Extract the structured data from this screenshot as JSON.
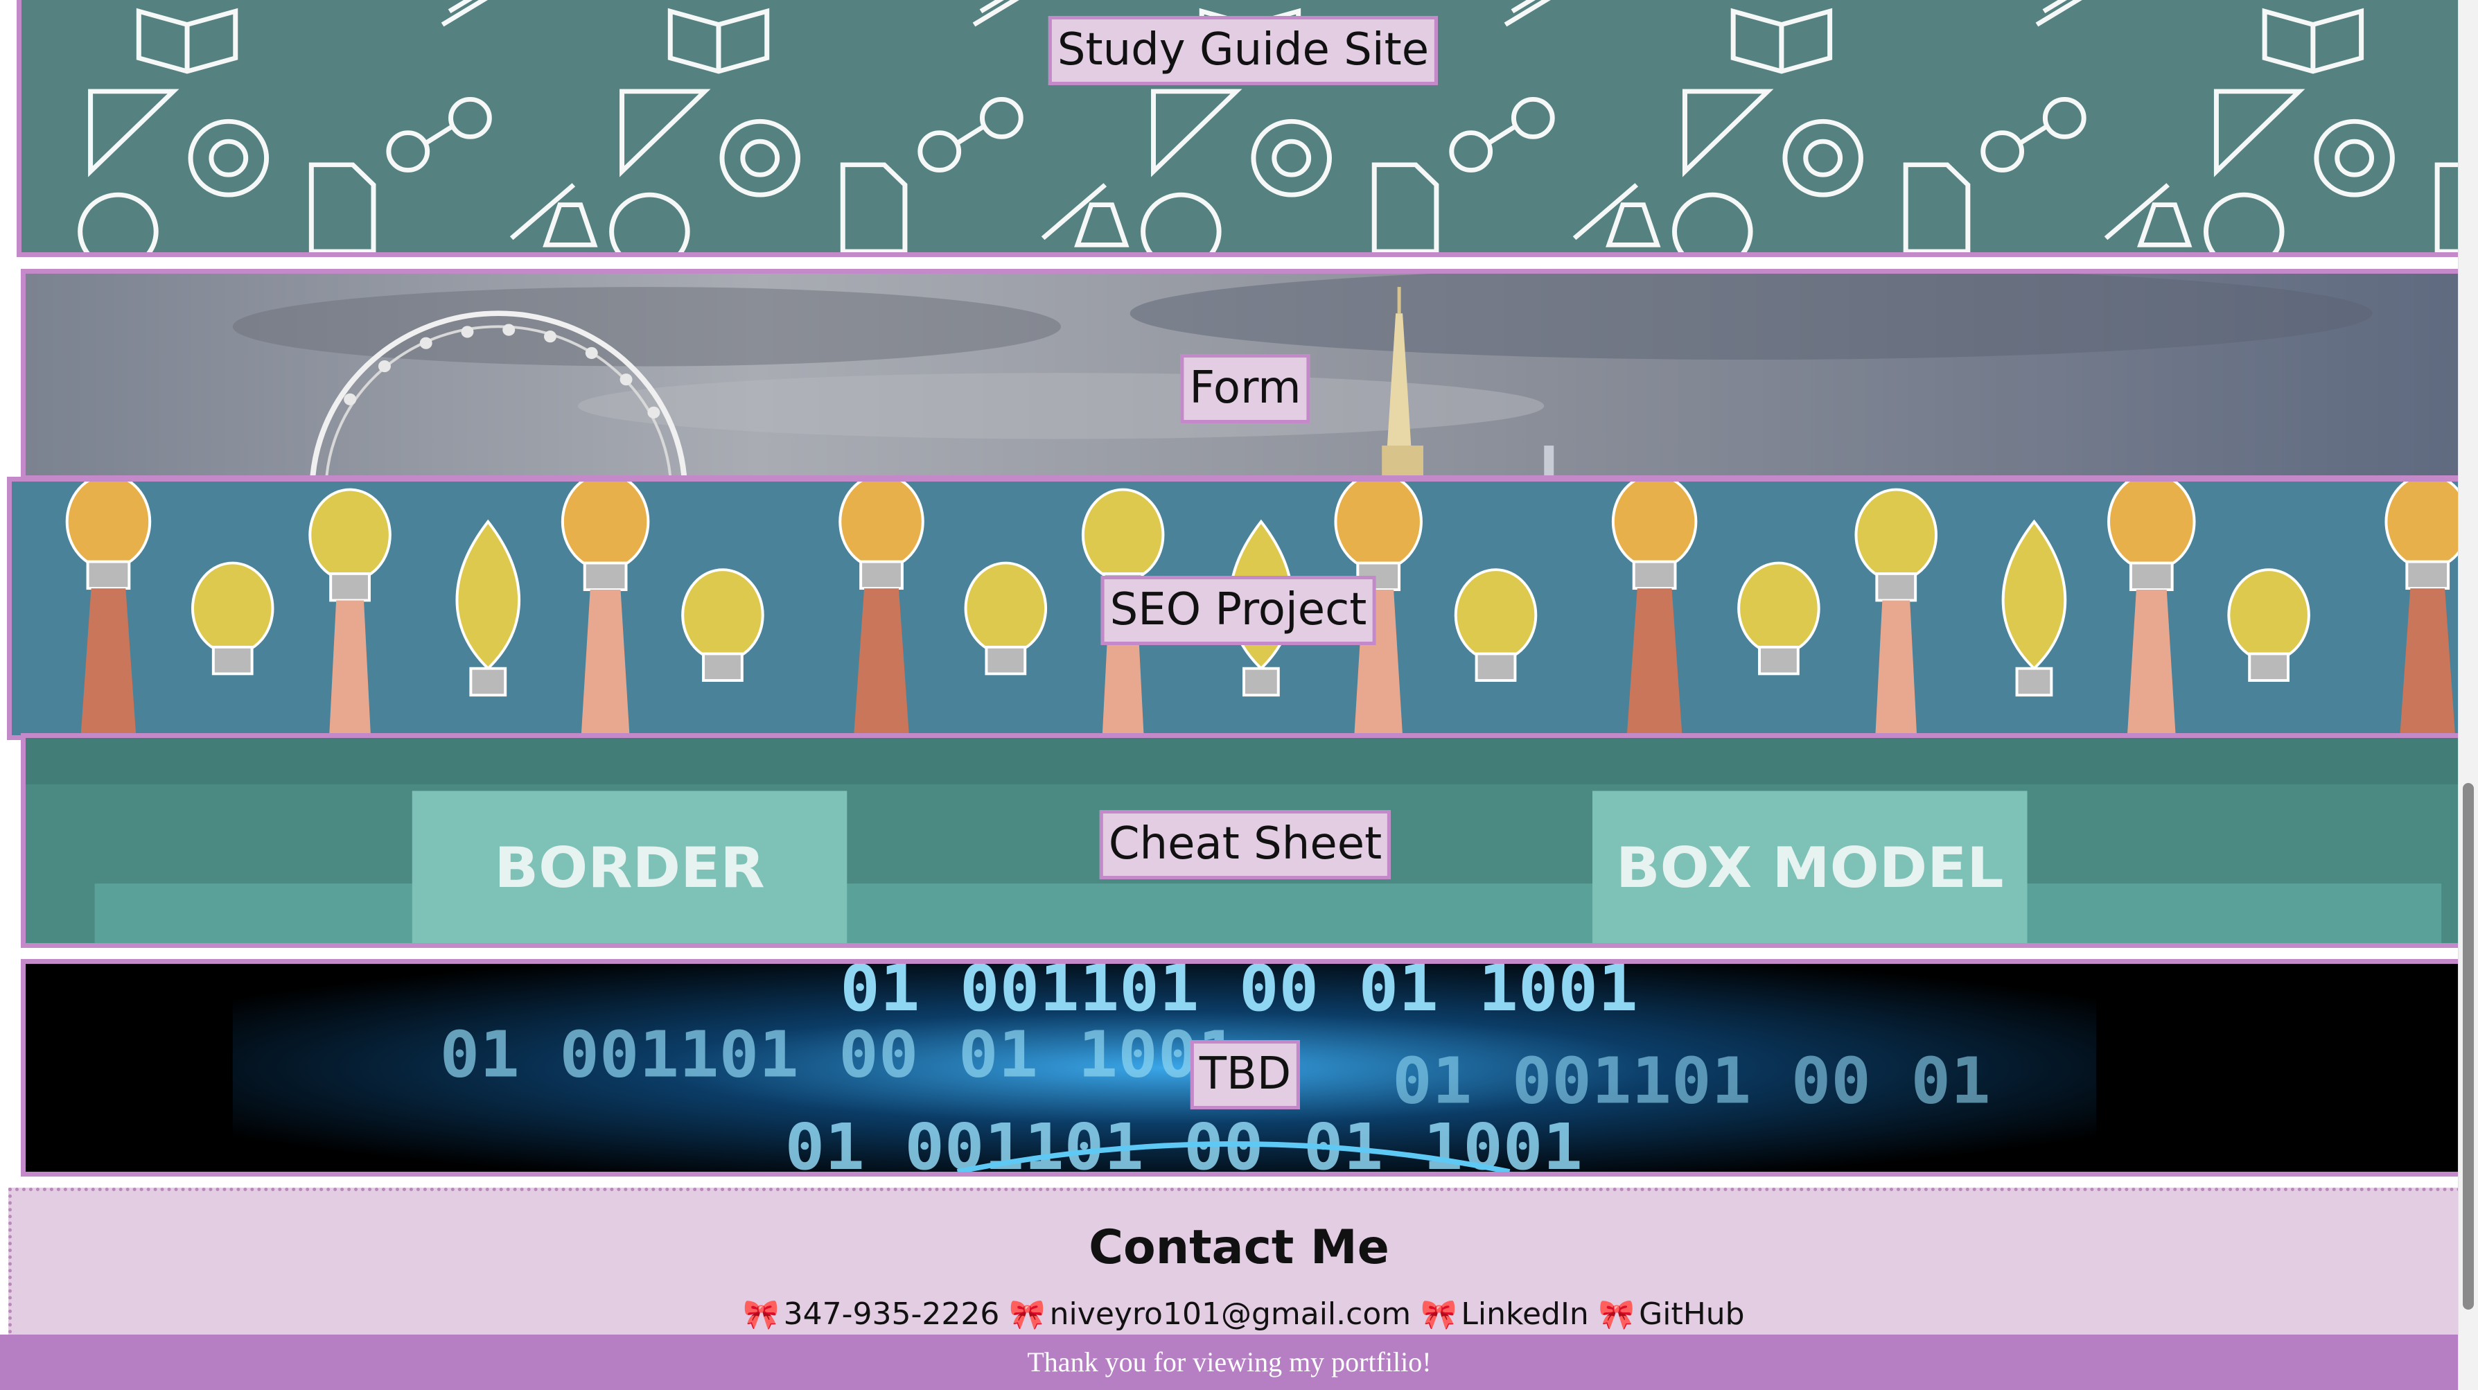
{
  "projects": [
    {
      "id": "study",
      "label": "Study Guide Site"
    },
    {
      "id": "form",
      "label": "Form"
    },
    {
      "id": "seo",
      "label": "SEO Project"
    },
    {
      "id": "cheat",
      "label": "Cheat Sheet",
      "words": [
        "BORDER",
        "BOX MODEL"
      ]
    },
    {
      "id": "tbd",
      "label": "TBD",
      "binary_lines": [
        "01 001101 00 01 1001",
        "01 001101 00 01 1001",
        "01 001101 00 01",
        "01 001101 00 01 1001"
      ]
    }
  ],
  "contact": {
    "heading": "Contact Me",
    "phone": "347-935-2226",
    "email": "niveyro101@gmail.com",
    "linkedin": "LinkedIn",
    "github": "GitHub",
    "bullet_icon": "ribbon-bow-icon"
  },
  "footer": {
    "text": "Thank you for viewing my portfilio!"
  },
  "colors": {
    "accent_border": "#c389c8",
    "label_bg": "#e3cde3",
    "contact_bg": "#e2cde2",
    "footer_bg": "#b67fc4",
    "study_bg": "#558280",
    "seo_bg": "#4a8299",
    "cheat_bg": "#4b8a83"
  }
}
